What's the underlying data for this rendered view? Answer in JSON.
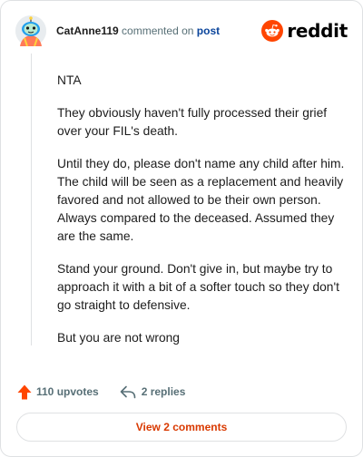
{
  "header": {
    "username": "CatAnne119",
    "action_text": "commented on",
    "post_link": "post",
    "brand": "reddit"
  },
  "comment": {
    "paragraphs": [
      "NTA",
      "They obviously haven't fully processed their grief over your FIL's death.",
      "Until they do, please don't name any child after him. The child will be seen as a replacement and heavily favored and not allowed to be their own person. Always compared to the deceased. Assumed they are the same.",
      "Stand your ground. Don't give in, but maybe try to approach it with a bit of a softer touch so they don't go straight to defensive.",
      "But you are not wrong"
    ]
  },
  "actions": {
    "upvotes": "110 upvotes",
    "replies": "2 replies"
  },
  "footer": {
    "view_comments": "View 2 comments"
  },
  "icons": {
    "upvote": "upvote-arrow-icon",
    "reply": "reply-arrow-icon",
    "logo": "reddit-snoo-icon",
    "avatar": "snoo-avatar"
  },
  "colors": {
    "accent": "#d93900",
    "upvote": "#ff4500",
    "link": "#0a449b",
    "muted": "#576f76"
  }
}
